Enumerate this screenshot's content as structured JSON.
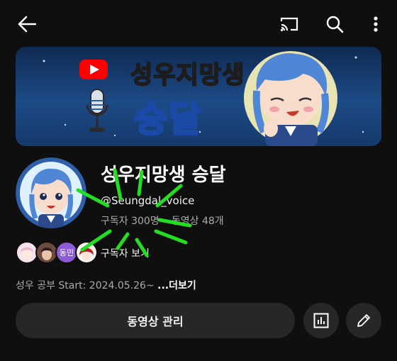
{
  "topbar": {
    "icons": [
      "back-arrow-icon",
      "cast-icon",
      "search-icon",
      "more-vert-icon"
    ]
  },
  "banner": {
    "title": "성우지망생",
    "subtitle": "승달",
    "logo": "youtube-logo-icon",
    "mic": "microphone-icon"
  },
  "channel": {
    "name": "성우지망생 승달",
    "handle": "@Seungdal_voice",
    "stats": "구독자 300명 • 동영상 48개"
  },
  "subscribers": {
    "link_label": "구독자 보기",
    "avatars": [
      {
        "label": "",
        "color": "#f3d4e4"
      },
      {
        "label": "",
        "color": "#5a3b34"
      },
      {
        "label": "동민",
        "color": "#8e5bd6"
      },
      {
        "label": "",
        "color": "#c62828"
      }
    ]
  },
  "description": {
    "text": "성우 공부 Start: 2024.05.26~ ",
    "more": "...더보기"
  },
  "actions": {
    "manage_label": "동영상 관리",
    "analytics_icon": "analytics-icon",
    "edit_icon": "edit-pencil-icon"
  },
  "colors": {
    "background": "#0f0f0f",
    "button": "#272727",
    "annotation": "#22dd22"
  }
}
